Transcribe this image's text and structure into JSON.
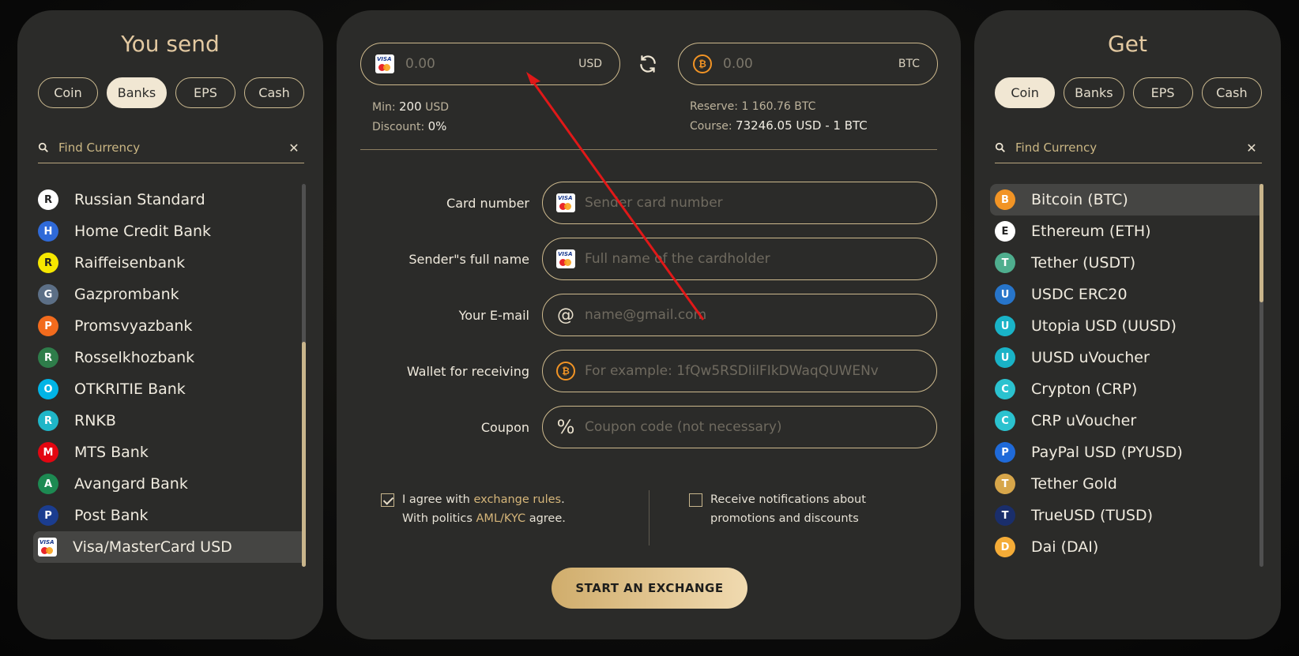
{
  "send_panel": {
    "title": "You send",
    "chips": [
      "Coin",
      "Banks",
      "EPS",
      "Cash"
    ],
    "active_chip": "Banks",
    "search_placeholder": "Find Currency",
    "items": [
      {
        "label": "Russian Standard",
        "icon": "russian-standard-icon",
        "color": "#ffffff"
      },
      {
        "label": "Home Credit Bank",
        "icon": "home-credit-icon",
        "color": "#2f6ad8"
      },
      {
        "label": "Raiffeisenbank",
        "icon": "raiffeisen-icon",
        "color": "#f6e700"
      },
      {
        "label": "Gazprombank",
        "icon": "gazprombank-icon",
        "color": "#5c6f86"
      },
      {
        "label": "Promsvyazbank",
        "icon": "promsvyazbank-icon",
        "color": "#f26b1d"
      },
      {
        "label": "Rosselkhozbank",
        "icon": "rosselkhozbank-icon",
        "color": "#2e7d4a"
      },
      {
        "label": "OTKRITIE Bank",
        "icon": "otkritie-icon",
        "color": "#00b4e6"
      },
      {
        "label": "RNKB",
        "icon": "rnkb-icon",
        "color": "#1fb6c8"
      },
      {
        "label": "MTS Bank",
        "icon": "mts-icon",
        "color": "#e30611"
      },
      {
        "label": "Avangard Bank",
        "icon": "avangard-icon",
        "color": "#1d8a52"
      },
      {
        "label": "Post Bank",
        "icon": "post-bank-icon",
        "color": "#1b3d8f"
      },
      {
        "label": "Visa/MasterCard USD",
        "icon": "visa-mastercard-icon",
        "color": "#ffffff"
      }
    ],
    "selected_index": 11
  },
  "exchange": {
    "send_amount_placeholder": "0.00",
    "send_currency": "USD",
    "get_amount_placeholder": "0.00",
    "get_currency": "BTC",
    "min_label": "Min:",
    "min_value": "200",
    "min_unit": "USD",
    "discount_label": "Discount:",
    "discount_value": "0%",
    "reserve": "Reserve: 1 160.76 BTC",
    "course_label": "Course:",
    "course_value": "73246.05 USD - 1 BTC",
    "fields": [
      {
        "label": "Card number",
        "placeholder": "Sender card number",
        "icon": "visa-mastercard-icon"
      },
      {
        "label": "Sender\"s full name",
        "placeholder": "Full name of the cardholder",
        "icon": "visa-mastercard-icon"
      },
      {
        "label": "Your E-mail",
        "placeholder": "name@gmail.com",
        "icon": "at-icon"
      },
      {
        "label": "Wallet for receiving",
        "placeholder": "For example: 1fQw5RSDlilFIkDWaqQUWENv",
        "icon": "bitcoin-icon"
      },
      {
        "label": "Coupon",
        "placeholder": "Coupon code (not necessary)",
        "icon": "percent-icon"
      }
    ],
    "agree_text_1": "I agree with",
    "agree_link_1": "exchange rules",
    "agree_text_2": "With politics",
    "agree_link_2": "AML/KYC",
    "agree_text_3": "agree.",
    "agree_checked": true,
    "notify_text": "Receive notifications about promotions and discounts",
    "notify_checked": false,
    "start_button": "START AN EXCHANGE"
  },
  "get_panel": {
    "title": "Get",
    "chips": [
      "Coin",
      "Banks",
      "EPS",
      "Cash"
    ],
    "active_chip": "Coin",
    "search_placeholder": "Find Currency",
    "items": [
      {
        "label": "Bitcoin (BTC)",
        "icon": "bitcoin-icon",
        "color": "#f29425"
      },
      {
        "label": "Ethereum (ETH)",
        "icon": "ethereum-icon",
        "color": "#ffffff"
      },
      {
        "label": "Tether (USDT)",
        "icon": "tether-icon",
        "color": "#4fae8e"
      },
      {
        "label": "USDC ERC20",
        "icon": "usdc-icon",
        "color": "#2775ca"
      },
      {
        "label": "Utopia USD (UUSD)",
        "icon": "utopia-usd-icon",
        "color": "#19b3c7"
      },
      {
        "label": "UUSD uVoucher",
        "icon": "uusd-voucher-icon",
        "color": "#19b3c7"
      },
      {
        "label": "Crypton (CRP)",
        "icon": "crypton-icon",
        "color": "#2bc2cf"
      },
      {
        "label": "CRP uVoucher",
        "icon": "crp-voucher-icon",
        "color": "#2bc2cf"
      },
      {
        "label": "PayPal USD (PYUSD)",
        "icon": "paypal-usd-icon",
        "color": "#1f6ad9"
      },
      {
        "label": "Tether Gold",
        "icon": "tether-gold-icon",
        "color": "#d7a64a"
      },
      {
        "label": "TrueUSD (TUSD)",
        "icon": "trueusd-icon",
        "color": "#1a2e6b"
      },
      {
        "label": "Dai (DAI)",
        "icon": "dai-icon",
        "color": "#f5ac37"
      }
    ],
    "selected_index": 0
  }
}
